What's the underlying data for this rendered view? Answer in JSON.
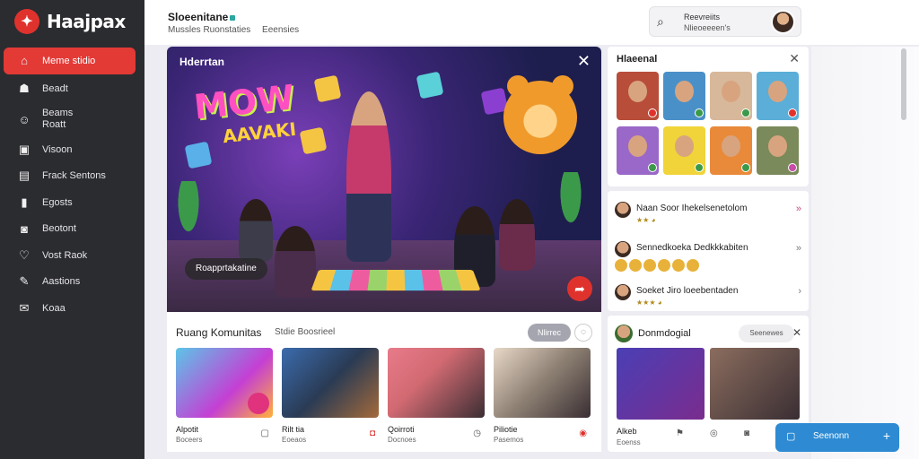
{
  "brand": {
    "name": "Haajpax"
  },
  "sidebar": {
    "items": [
      {
        "label": "Meme stidio",
        "icon": "home-icon",
        "active": true
      },
      {
        "label": "Beadt",
        "icon": "flame-icon"
      },
      {
        "label": "Beams Roatt",
        "icon": "people-icon"
      },
      {
        "label": "Visoon",
        "icon": "video-icon"
      },
      {
        "label": "Frack Sentons",
        "icon": "layers-icon"
      },
      {
        "label": "Egosts",
        "icon": "bell-icon"
      },
      {
        "label": "Beotont",
        "icon": "camera-icon"
      },
      {
        "label": "Vost Raok",
        "icon": "heart-icon"
      },
      {
        "label": "Aastions",
        "icon": "edit-icon"
      },
      {
        "label": "Koaa",
        "icon": "message-icon"
      }
    ]
  },
  "header": {
    "title": "Sloeenitane",
    "subtitle_a": "Mussles Ruonstaties",
    "subtitle_b": "Eeensies"
  },
  "search": {
    "line1": "Reevreiits",
    "line2": "Nlieoeeeen's"
  },
  "hero": {
    "title": "Hderrtan",
    "headline1": "MOW",
    "headline2": "AAVAKI",
    "chip": "Roapprtakatine"
  },
  "community": {
    "title": "Ruang Komunitas",
    "subtitle": "Stdie Boosrieel",
    "button": "Nlirrec",
    "cards": [
      {
        "title": "Alpotit",
        "sub": "Boceers",
        "color": "#c43fd4"
      },
      {
        "title": "Rilt tia",
        "sub": "Eoeaos",
        "color": "#3b6cae"
      },
      {
        "title": "Qoirroti",
        "sub": "Docnoes",
        "color": "#d26a72"
      },
      {
        "title": "Piliotie",
        "sub": "Pasemos",
        "color": "#8c7f72"
      }
    ]
  },
  "friends": {
    "title": "Hlaeenal"
  },
  "chats": [
    {
      "name": "Naan Soor Ihekelsenetolom",
      "meta": "★★ ◕"
    },
    {
      "name": "Sennedkoeka Dedkkkabiten",
      "meta": ""
    },
    {
      "name": "Soeket Jiro loeebentaden",
      "meta": "★★★ ◕"
    }
  ],
  "digital": {
    "title": "Donmdogial",
    "button": "Seenewes",
    "label": "Alkeb",
    "sub": "Eoenss"
  },
  "fab": {
    "label": "Seenonn"
  }
}
